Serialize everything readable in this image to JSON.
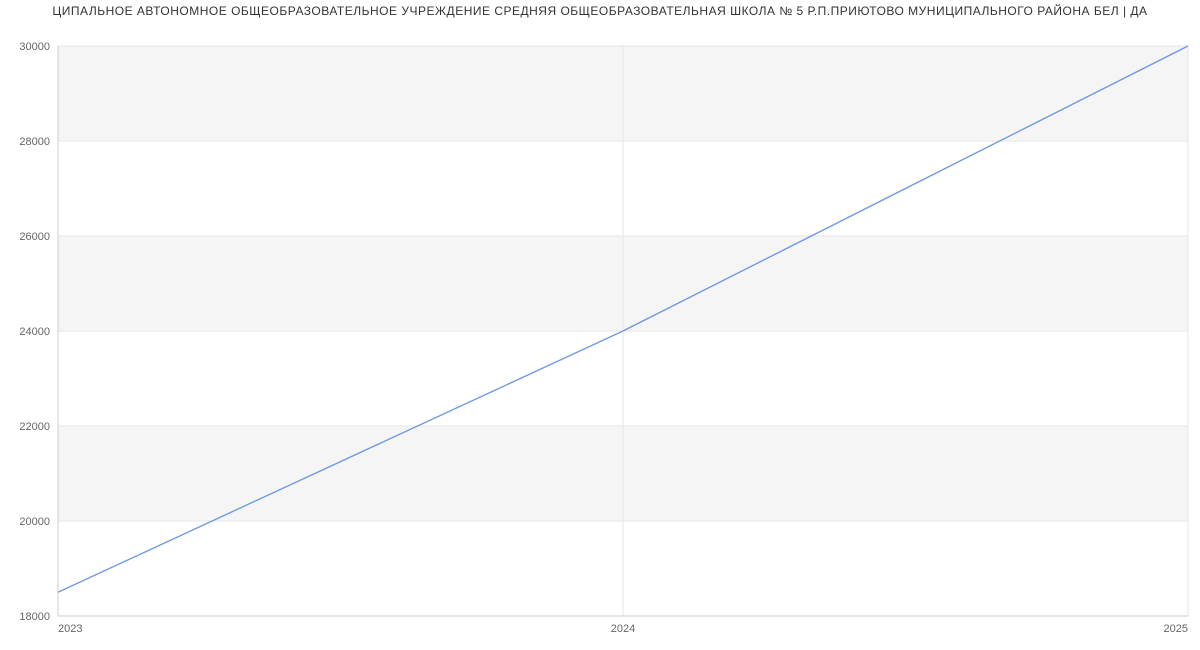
{
  "title": "ЦИПАЛЬНОЕ АВТОНОМНОЕ ОБЩЕОБРАЗОВАТЕЛЬНОЕ УЧРЕЖДЕНИЕ СРЕДНЯЯ ОБЩЕОБРАЗОВАТЕЛЬНАЯ ШКОЛА № 5 Р.П.ПРИЮТОВО МУНИЦИПАЛЬНОГО РАЙОНА БЕЛ | ДА",
  "chart_data": {
    "type": "line",
    "x": [
      2023,
      2024,
      2025
    ],
    "series": [
      {
        "name": "",
        "values": [
          18500,
          24000,
          30000
        ]
      }
    ],
    "title": "",
    "xlabel": "",
    "ylabel": "",
    "xlim": [
      2023,
      2025
    ],
    "ylim": [
      18000,
      30000
    ],
    "yticks": [
      18000,
      20000,
      22000,
      24000,
      26000,
      28000,
      30000
    ],
    "xticks": [
      2023,
      2024,
      2025
    ],
    "grid": true
  },
  "colors": {
    "line": "#6f9ae3",
    "band": "#f5f5f5",
    "grid": "#e6e6e6",
    "axis": "#cccccc",
    "tick_text": "#666666"
  }
}
